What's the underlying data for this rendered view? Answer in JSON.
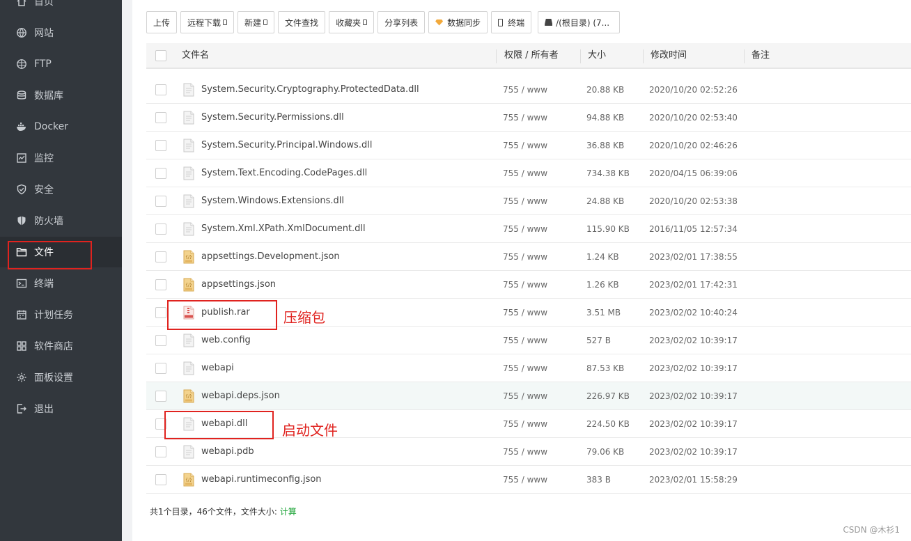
{
  "sidebar": {
    "items": [
      {
        "id": "home",
        "label": "首页",
        "icon": "home-icon"
      },
      {
        "id": "website",
        "label": "网站",
        "icon": "globe-icon"
      },
      {
        "id": "ftp",
        "label": "FTP",
        "icon": "ftp-icon"
      },
      {
        "id": "database",
        "label": "数据库",
        "icon": "database-icon"
      },
      {
        "id": "docker",
        "label": "Docker",
        "icon": "docker-icon"
      },
      {
        "id": "monitor",
        "label": "监控",
        "icon": "monitor-icon"
      },
      {
        "id": "security",
        "label": "安全",
        "icon": "shield-check-icon"
      },
      {
        "id": "firewall",
        "label": "防火墙",
        "icon": "shield-icon"
      },
      {
        "id": "files",
        "label": "文件",
        "icon": "folder-icon",
        "active": true
      },
      {
        "id": "terminal",
        "label": "终端",
        "icon": "terminal-icon"
      },
      {
        "id": "cron",
        "label": "计划任务",
        "icon": "calendar-icon"
      },
      {
        "id": "store",
        "label": "软件商店",
        "icon": "grid-icon"
      },
      {
        "id": "settings",
        "label": "面板设置",
        "icon": "gear-icon"
      },
      {
        "id": "logout",
        "label": "退出",
        "icon": "logout-icon"
      }
    ]
  },
  "toolbar": {
    "upload": "上传",
    "remote_download": "远程下载",
    "new": "新建",
    "file_search": "文件查找",
    "favorites": "收藏夹",
    "share_list": "分享列表",
    "data_sync": "数据同步",
    "terminal": "终端",
    "path": "/(根目录) (7..."
  },
  "table": {
    "headers": {
      "name": "文件名",
      "perm": "权限 / 所有者",
      "size": "大小",
      "mtime": "修改时间",
      "note": "备注"
    },
    "rows": [
      {
        "name": "System.Security.Cryptography.ProtectedData.dll",
        "perm": "755 / www",
        "size": "20.88 KB",
        "mtime": "2020/10/20 02:52:26",
        "type": "file"
      },
      {
        "name": "System.Security.Permissions.dll",
        "perm": "755 / www",
        "size": "94.88 KB",
        "mtime": "2020/10/20 02:53:40",
        "type": "file"
      },
      {
        "name": "System.Security.Principal.Windows.dll",
        "perm": "755 / www",
        "size": "36.88 KB",
        "mtime": "2020/10/20 02:46:26",
        "type": "file"
      },
      {
        "name": "System.Text.Encoding.CodePages.dll",
        "perm": "755 / www",
        "size": "734.38 KB",
        "mtime": "2020/04/15 06:39:06",
        "type": "file"
      },
      {
        "name": "System.Windows.Extensions.dll",
        "perm": "755 / www",
        "size": "24.88 KB",
        "mtime": "2020/10/20 02:53:38",
        "type": "file"
      },
      {
        "name": "System.Xml.XPath.XmlDocument.dll",
        "perm": "755 / www",
        "size": "115.90 KB",
        "mtime": "2016/11/05 12:57:34",
        "type": "file"
      },
      {
        "name": "appsettings.Development.json",
        "perm": "755 / www",
        "size": "1.24 KB",
        "mtime": "2023/02/01 17:38:55",
        "type": "json"
      },
      {
        "name": "appsettings.json",
        "perm": "755 / www",
        "size": "1.26 KB",
        "mtime": "2023/02/01 17:42:31",
        "type": "json"
      },
      {
        "name": "publish.rar",
        "perm": "755 / www",
        "size": "3.51 MB",
        "mtime": "2023/02/02 10:40:24",
        "type": "rar"
      },
      {
        "name": "web.config",
        "perm": "755 / www",
        "size": "527 B",
        "mtime": "2023/02/02 10:39:17",
        "type": "file"
      },
      {
        "name": "webapi",
        "perm": "755 / www",
        "size": "87.53 KB",
        "mtime": "2023/02/02 10:39:17",
        "type": "file"
      },
      {
        "name": "webapi.deps.json",
        "perm": "755 / www",
        "size": "226.97 KB",
        "mtime": "2023/02/02 10:39:17",
        "type": "json",
        "hover": true
      },
      {
        "name": "webapi.dll",
        "perm": "755 / www",
        "size": "224.50 KB",
        "mtime": "2023/02/02 10:39:17",
        "type": "file"
      },
      {
        "name": "webapi.pdb",
        "perm": "755 / www",
        "size": "79.06 KB",
        "mtime": "2023/02/02 10:39:17",
        "type": "file"
      },
      {
        "name": "webapi.runtimeconfig.json",
        "perm": "755 / www",
        "size": "383 B",
        "mtime": "2023/02/01 15:58:29",
        "type": "json"
      }
    ]
  },
  "footer": {
    "summary": "共1个目录，46个文件，文件大小: ",
    "calc": "计算"
  },
  "annotations": {
    "archive": "压缩包",
    "startup": "启动文件"
  },
  "watermark": "CSDN @木衫1",
  "colors": {
    "sidebar_bg": "#32373d",
    "accent_green": "#20a53a",
    "annotation_red": "#e0231f"
  }
}
